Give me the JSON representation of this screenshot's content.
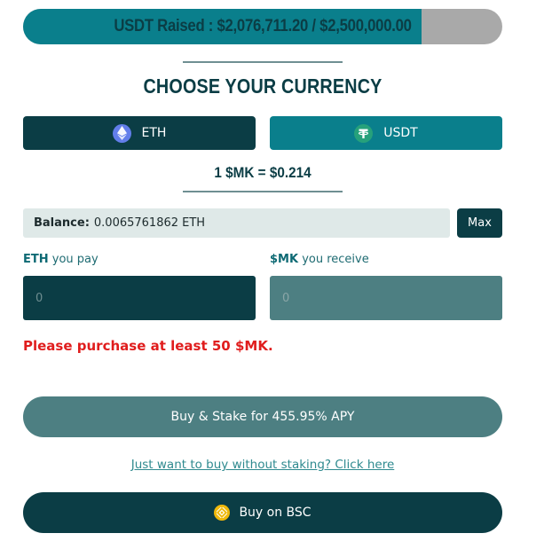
{
  "progress": {
    "text": "USDT Raised : $2,076,711.20 / $2,500,000.00",
    "raised": 2076711.2,
    "goal": 2500000.0,
    "fraction": 0.8307
  },
  "heading": "CHOOSE YOUR CURRENCY",
  "currencies": [
    {
      "label": "ETH",
      "icon": "ethereum-icon",
      "selected": true,
      "color": "#0b3d45"
    },
    {
      "label": "USDT",
      "icon": "tether-icon",
      "selected": false,
      "color": "#0a7f8c"
    }
  ],
  "rate": "1 $MK = $0.214",
  "balance": {
    "label": "Balance:",
    "value": "0.0065761862 ETH"
  },
  "max_label": "Max",
  "pay": {
    "currency": "ETH",
    "text": "you pay",
    "placeholder": "0"
  },
  "receive": {
    "currency": "$MK",
    "text": "you receive",
    "placeholder": "0"
  },
  "error": "Please purchase at least 50 $MK.",
  "stake_button": "Buy & Stake for 455.95% APY",
  "no_stake_link": "Just want to buy without staking? Click here",
  "bsc_button": "Buy on BSC",
  "colors": {
    "dark_teal": "#0b3d45",
    "teal": "#0a7f8c",
    "muted_teal": "#4d7f82",
    "error": "#e01d1d",
    "bnb_gold": "#f0b90b"
  }
}
